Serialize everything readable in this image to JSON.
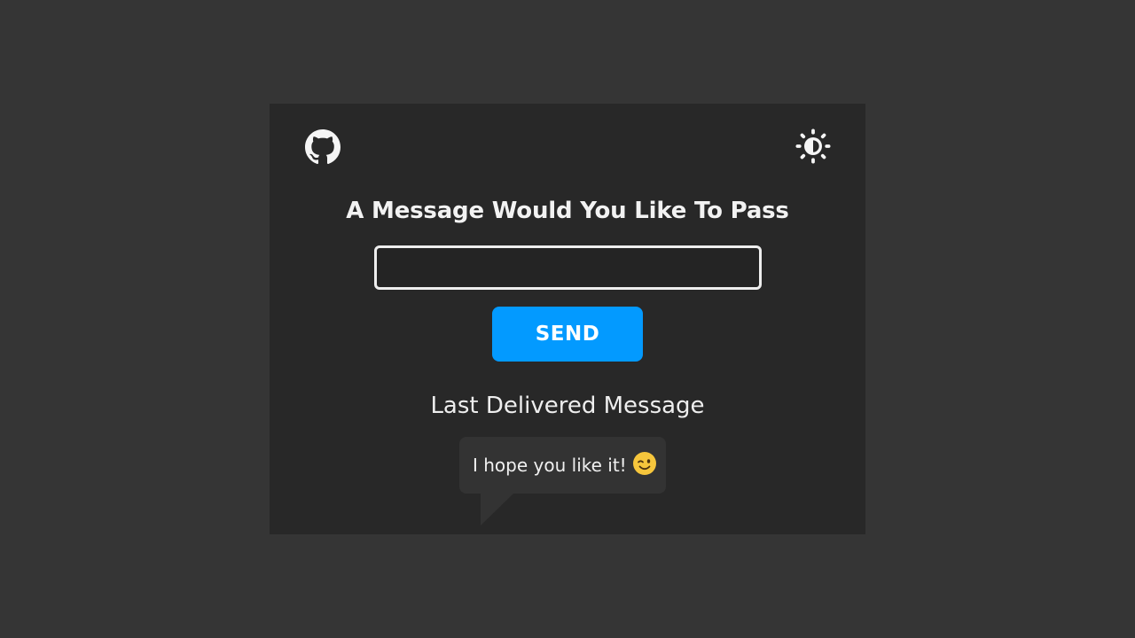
{
  "header": {
    "github_icon": "github-icon",
    "theme_icon": "brightness-contrast-icon"
  },
  "form": {
    "heading": "A Message Would You Like To Pass",
    "input_value": "",
    "input_placeholder": "",
    "send_label": "SEND"
  },
  "delivered": {
    "label": "Last Delivered Message",
    "message": "I hope you like it!",
    "emoji": "winking-face-icon"
  },
  "colors": {
    "page_bg": "#353535",
    "card_bg": "#282828",
    "accent": "#039aff",
    "bubble_bg": "#333333"
  }
}
